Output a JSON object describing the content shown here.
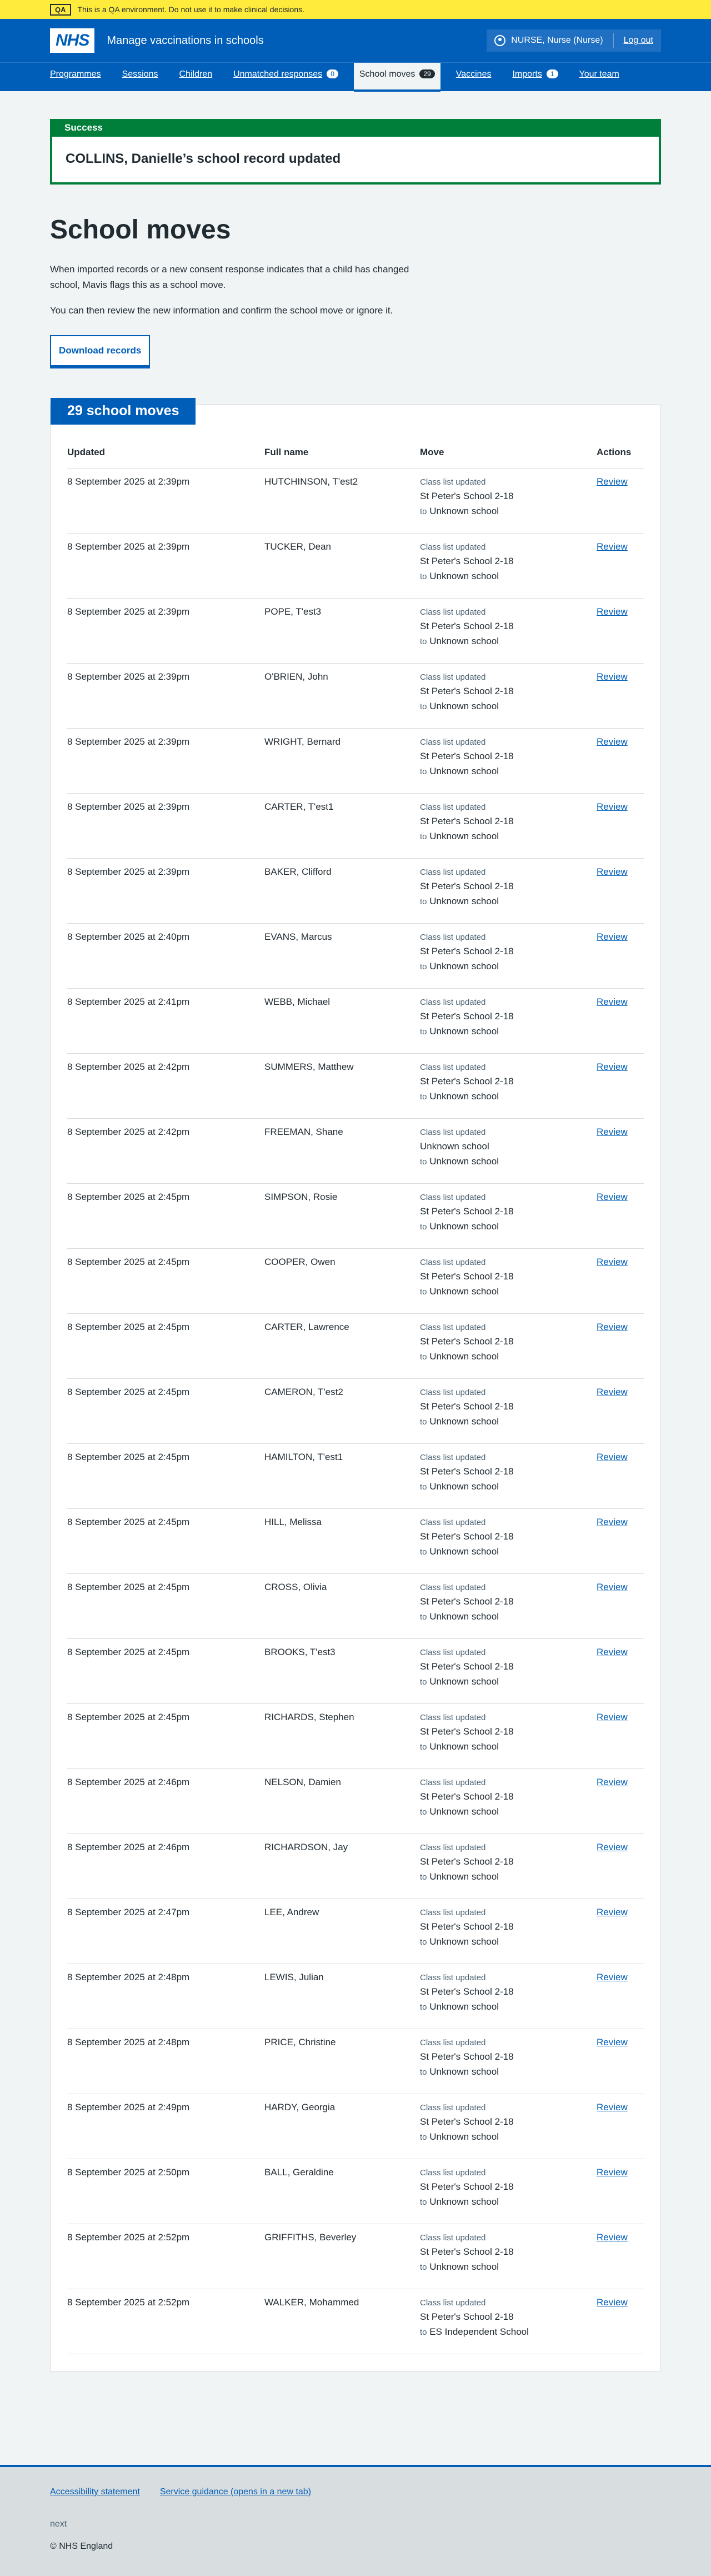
{
  "qa_banner": {
    "tag": "QA",
    "text": "This is a QA environment. Do not use it to make clinical decisions."
  },
  "header": {
    "logo": "NHS",
    "service_name": "Manage vaccinations in schools",
    "account_name": "NURSE, Nurse (Nurse)",
    "logout_label": "Log out"
  },
  "nav": [
    {
      "label": "Programmes",
      "badge": ""
    },
    {
      "label": "Sessions",
      "badge": ""
    },
    {
      "label": "Children",
      "badge": ""
    },
    {
      "label": "Unmatched responses",
      "badge": "0"
    },
    {
      "label": "School moves",
      "badge": "29",
      "active": true
    },
    {
      "label": "Vaccines",
      "badge": ""
    },
    {
      "label": "Imports",
      "badge": "1"
    },
    {
      "label": "Your team",
      "badge": ""
    }
  ],
  "success": {
    "title": "Success",
    "message": "COLLINS, Danielle’s school record updated"
  },
  "page": {
    "title": "School moves",
    "intro_1": "When imported records or a new consent response indicates that a child has changed school, Mavis flags this as a school move.",
    "intro_2": "You can then review the new information and confirm the school move or ignore it.",
    "download_label": "Download records"
  },
  "table": {
    "heading": "29 school moves",
    "columns": [
      "Updated",
      "Full name",
      "Move",
      "Actions"
    ],
    "to_label": "to",
    "rows": [
      {
        "updated": "8 September 2025 at 2:39pm",
        "name": "HUTCHINSON, T'est2",
        "source": "Class list updated",
        "from": "St Peter's School 2-18",
        "to": "Unknown school",
        "action": "Review"
      },
      {
        "updated": "8 September 2025 at 2:39pm",
        "name": "TUCKER, Dean",
        "source": "Class list updated",
        "from": "St Peter's School 2-18",
        "to": "Unknown school",
        "action": "Review"
      },
      {
        "updated": "8 September 2025 at 2:39pm",
        "name": "POPE, T'est3",
        "source": "Class list updated",
        "from": "St Peter's School 2-18",
        "to": "Unknown school",
        "action": "Review"
      },
      {
        "updated": "8 September 2025 at 2:39pm",
        "name": "O'BRIEN, John",
        "source": "Class list updated",
        "from": "St Peter's School 2-18",
        "to": "Unknown school",
        "action": "Review"
      },
      {
        "updated": "8 September 2025 at 2:39pm",
        "name": "WRIGHT, Bernard",
        "source": "Class list updated",
        "from": "St Peter's School 2-18",
        "to": "Unknown school",
        "action": "Review"
      },
      {
        "updated": "8 September 2025 at 2:39pm",
        "name": "CARTER, T'est1",
        "source": "Class list updated",
        "from": "St Peter's School 2-18",
        "to": "Unknown school",
        "action": "Review"
      },
      {
        "updated": "8 September 2025 at 2:39pm",
        "name": "BAKER, Clifford",
        "source": "Class list updated",
        "from": "St Peter's School 2-18",
        "to": "Unknown school",
        "action": "Review"
      },
      {
        "updated": "8 September 2025 at 2:40pm",
        "name": "EVANS, Marcus",
        "source": "Class list updated",
        "from": "St Peter's School 2-18",
        "to": "Unknown school",
        "action": "Review"
      },
      {
        "updated": "8 September 2025 at 2:41pm",
        "name": "WEBB, Michael",
        "source": "Class list updated",
        "from": "St Peter's School 2-18",
        "to": "Unknown school",
        "action": "Review"
      },
      {
        "updated": "8 September 2025 at 2:42pm",
        "name": "SUMMERS, Matthew",
        "source": "Class list updated",
        "from": "St Peter's School 2-18",
        "to": "Unknown school",
        "action": "Review"
      },
      {
        "updated": "8 September 2025 at 2:42pm",
        "name": "FREEMAN, Shane",
        "source": "Class list updated",
        "from": "Unknown school",
        "to": "Unknown school",
        "action": "Review"
      },
      {
        "updated": "8 September 2025 at 2:45pm",
        "name": "SIMPSON, Rosie",
        "source": "Class list updated",
        "from": "St Peter's School 2-18",
        "to": "Unknown school",
        "action": "Review"
      },
      {
        "updated": "8 September 2025 at 2:45pm",
        "name": "COOPER, Owen",
        "source": "Class list updated",
        "from": "St Peter's School 2-18",
        "to": "Unknown school",
        "action": "Review"
      },
      {
        "updated": "8 September 2025 at 2:45pm",
        "name": "CARTER, Lawrence",
        "source": "Class list updated",
        "from": "St Peter's School 2-18",
        "to": "Unknown school",
        "action": "Review"
      },
      {
        "updated": "8 September 2025 at 2:45pm",
        "name": "CAMERON, T'est2",
        "source": "Class list updated",
        "from": "St Peter's School 2-18",
        "to": "Unknown school",
        "action": "Review"
      },
      {
        "updated": "8 September 2025 at 2:45pm",
        "name": "HAMILTON, T'est1",
        "source": "Class list updated",
        "from": "St Peter's School 2-18",
        "to": "Unknown school",
        "action": "Review"
      },
      {
        "updated": "8 September 2025 at 2:45pm",
        "name": "HILL, Melissa",
        "source": "Class list updated",
        "from": "St Peter's School 2-18",
        "to": "Unknown school",
        "action": "Review"
      },
      {
        "updated": "8 September 2025 at 2:45pm",
        "name": "CROSS, Olivia",
        "source": "Class list updated",
        "from": "St Peter's School 2-18",
        "to": "Unknown school",
        "action": "Review"
      },
      {
        "updated": "8 September 2025 at 2:45pm",
        "name": "BROOKS, T'est3",
        "source": "Class list updated",
        "from": "St Peter's School 2-18",
        "to": "Unknown school",
        "action": "Review"
      },
      {
        "updated": "8 September 2025 at 2:45pm",
        "name": "RICHARDS, Stephen",
        "source": "Class list updated",
        "from": "St Peter's School 2-18",
        "to": "Unknown school",
        "action": "Review"
      },
      {
        "updated": "8 September 2025 at 2:46pm",
        "name": "NELSON, Damien",
        "source": "Class list updated",
        "from": "St Peter's School 2-18",
        "to": "Unknown school",
        "action": "Review"
      },
      {
        "updated": "8 September 2025 at 2:46pm",
        "name": "RICHARDSON, Jay",
        "source": "Class list updated",
        "from": "St Peter's School 2-18",
        "to": "Unknown school",
        "action": "Review"
      },
      {
        "updated": "8 September 2025 at 2:47pm",
        "name": "LEE, Andrew",
        "source": "Class list updated",
        "from": "St Peter's School 2-18",
        "to": "Unknown school",
        "action": "Review"
      },
      {
        "updated": "8 September 2025 at 2:48pm",
        "name": "LEWIS, Julian",
        "source": "Class list updated",
        "from": "St Peter's School 2-18",
        "to": "Unknown school",
        "action": "Review"
      },
      {
        "updated": "8 September 2025 at 2:48pm",
        "name": "PRICE, Christine",
        "source": "Class list updated",
        "from": "St Peter's School 2-18",
        "to": "Unknown school",
        "action": "Review"
      },
      {
        "updated": "8 September 2025 at 2:49pm",
        "name": "HARDY, Georgia",
        "source": "Class list updated",
        "from": "St Peter's School 2-18",
        "to": "Unknown school",
        "action": "Review"
      },
      {
        "updated": "8 September 2025 at 2:50pm",
        "name": "BALL, Geraldine",
        "source": "Class list updated",
        "from": "St Peter's School 2-18",
        "to": "Unknown school",
        "action": "Review"
      },
      {
        "updated": "8 September 2025 at 2:52pm",
        "name": "GRIFFITHS, Beverley",
        "source": "Class list updated",
        "from": "St Peter's School 2-18",
        "to": "Unknown school",
        "action": "Review"
      },
      {
        "updated": "8 September 2025 at 2:52pm",
        "name": "WALKER, Mohammed",
        "source": "Class list updated",
        "from": "St Peter's School 2-18",
        "to": "ES Independent School",
        "action": "Review"
      }
    ]
  },
  "footer": {
    "links": [
      "Accessibility statement",
      "Service guidance (opens in a new tab)"
    ],
    "version": "next",
    "copyright": "© NHS England"
  },
  "colors": {
    "primary_blue": "#005eb8",
    "success_green": "#007f3b",
    "qa_yellow": "#ffeb3b",
    "page_background": "#f0f4f5"
  }
}
